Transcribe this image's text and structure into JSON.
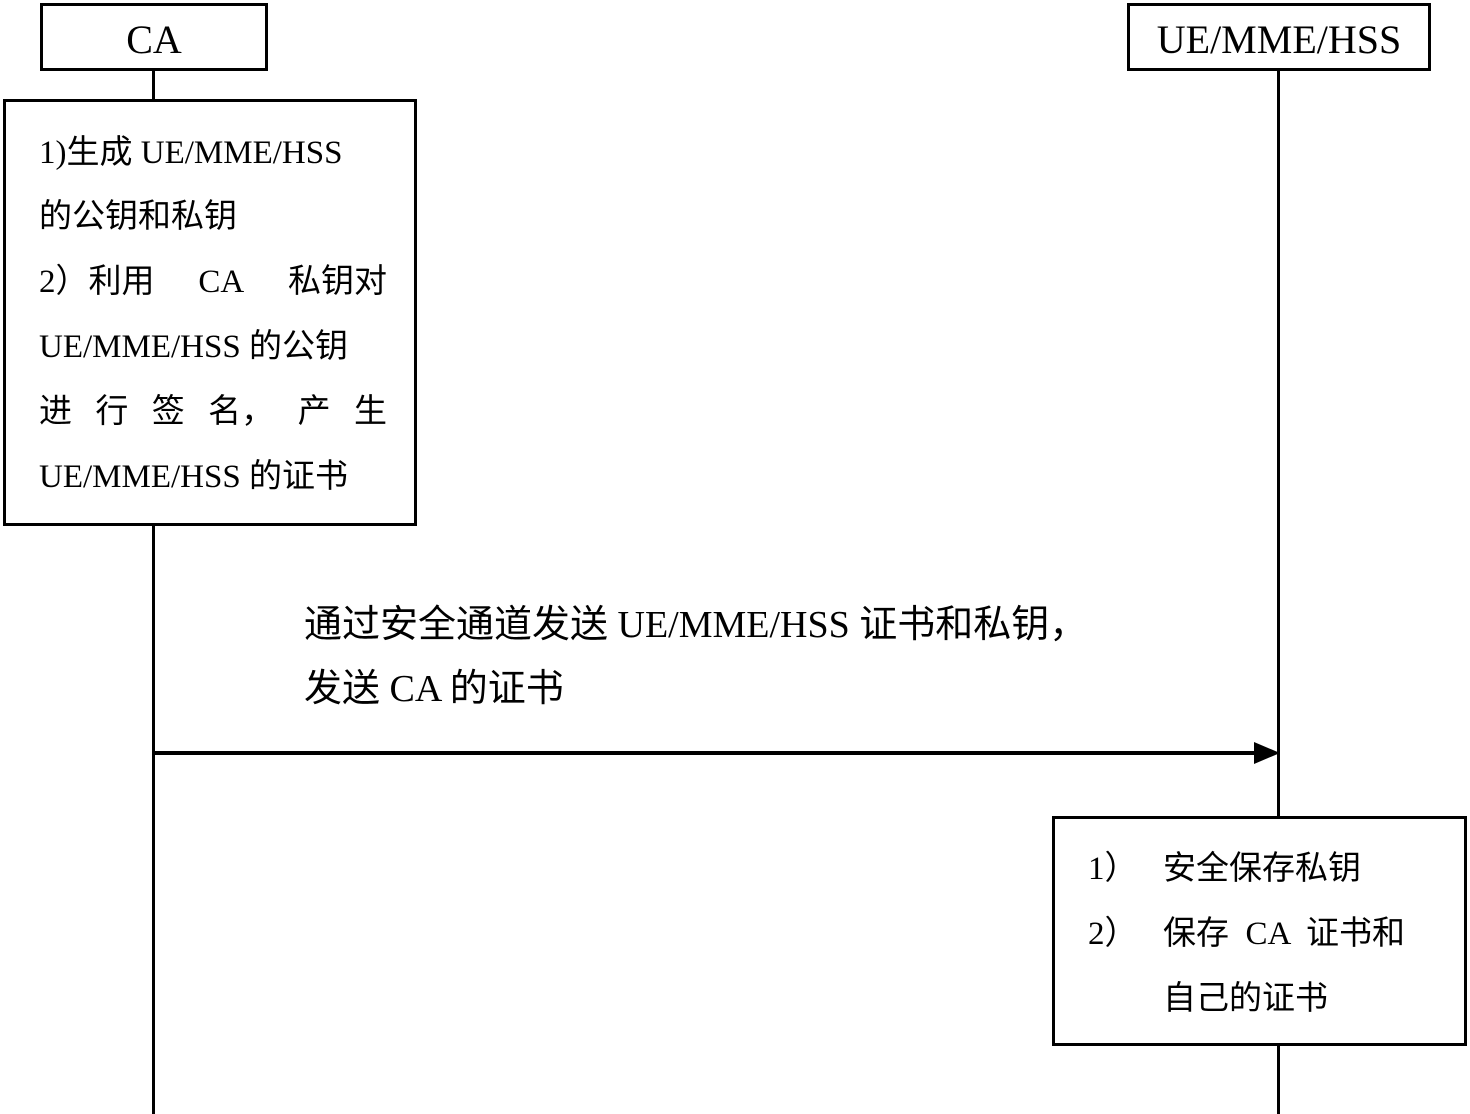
{
  "actors": {
    "left": {
      "label": "CA"
    },
    "right": {
      "label": "UE/MME/HSS"
    }
  },
  "notes": {
    "ca_process": {
      "lines": [
        "1)生成 UE/MME/HSS",
        "的公钥和私钥",
        "2）利用 CA 私钥对",
        "UE/MME/HSS 的公钥",
        "进行签名，产生",
        "UE/MME/HSS 的证书"
      ],
      "justified_line_words": [
        "进",
        "行",
        "签",
        "名，",
        "产",
        "生"
      ],
      "line3_words": [
        "2）利用",
        "CA",
        "私钥对"
      ]
    },
    "ue_process": {
      "lines": [
        "1）",
        "安全保存私钥",
        "2）",
        "保存  CA  证书和",
        "自己的证书"
      ]
    }
  },
  "message": {
    "direction": "CA → UE/MME/HSS",
    "lines": [
      "通过安全通道发送 UE/MME/HSS 证书和私钥，",
      "发送 CA 的证书"
    ]
  }
}
